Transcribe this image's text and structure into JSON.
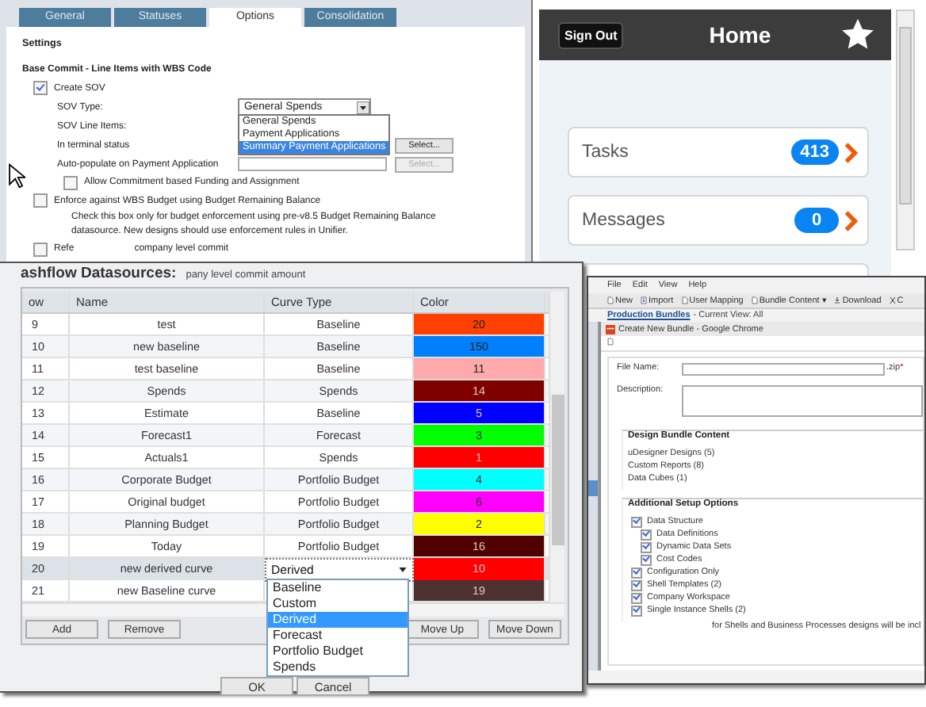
{
  "settings_window": {
    "tabs": [
      {
        "label": "General",
        "selected": false
      },
      {
        "label": "Statuses",
        "selected": false
      },
      {
        "label": "Options",
        "selected": true
      },
      {
        "label": "Consolidation",
        "selected": false
      }
    ],
    "section_title": "Settings",
    "group_title": "Base Commit - Line Items with WBS Code",
    "create_sov": {
      "label": "Create SOV",
      "checked": true
    },
    "fields": [
      {
        "label": "SOV Type:",
        "kind": "dropdown",
        "value": "General Spends"
      },
      {
        "label": "SOV Line Items:",
        "kind": "blank"
      },
      {
        "label": "In terminal status",
        "kind": "select",
        "button": "Select...",
        "disabled": false
      },
      {
        "label": "Auto-populate on Payment Application",
        "kind": "select",
        "button": "Select...",
        "disabled": true
      }
    ],
    "sov_options": [
      {
        "label": "General Spends",
        "selected": false
      },
      {
        "label": "Payment Applications",
        "selected": false
      },
      {
        "label": "Summary Payment Applications",
        "selected": true
      }
    ],
    "allow_commitment": {
      "label": "Allow Commitment based Funding and Assignment",
      "checked": false
    },
    "enforce": {
      "label": "Enforce against WBS Budget using Budget Remaining Balance",
      "checked": false,
      "note": "Check this box only for budget enforcement using pre-v8.5 Budget Remaining Balance datasource. New designs should use enforcement rules in Unifier."
    },
    "refer": {
      "label_start": "Refe",
      "label_end": "company level commit",
      "checked": false
    }
  },
  "mobile_app": {
    "sign_out": "Sign Out",
    "title": "Home",
    "items": [
      {
        "label": "Tasks",
        "count": "413"
      },
      {
        "label": "Messages",
        "count": "0"
      }
    ]
  },
  "datasources_dialog": {
    "heading": "ashflow Datasources:",
    "cut_line": "pany level commit amount",
    "columns": [
      "ow",
      "Name",
      "Curve Type",
      "Color"
    ],
    "rows": [
      {
        "row": "9",
        "name": "test",
        "curve_type": "Baseline",
        "color_value": "20",
        "color": "#ff4000",
        "selected": false
      },
      {
        "row": "10",
        "name": "new baseline",
        "curve_type": "Baseline",
        "color_value": "150",
        "color": "#0080ff",
        "selected": false
      },
      {
        "row": "11",
        "name": "test baseline",
        "curve_type": "Baseline",
        "color_value": "11",
        "color": "#ffaaaa",
        "selected": false
      },
      {
        "row": "12",
        "name": "Spends",
        "curve_type": "Spends",
        "color_value": "14",
        "color": "#800000",
        "selected": false
      },
      {
        "row": "13",
        "name": "Estimate",
        "curve_type": "Baseline",
        "color_value": "5",
        "color": "#0000ff",
        "selected": false
      },
      {
        "row": "14",
        "name": "Forecast1",
        "curve_type": "Forecast",
        "color_value": "3",
        "color": "#00ff00",
        "selected": false
      },
      {
        "row": "15",
        "name": "Actuals1",
        "curve_type": "Spends",
        "color_value": "1",
        "color": "#ff0000",
        "selected": false
      },
      {
        "row": "16",
        "name": "Corporate Budget",
        "curve_type": "Portfolio Budget",
        "color_value": "4",
        "color": "#00ffff",
        "selected": false
      },
      {
        "row": "17",
        "name": "Original budget",
        "curve_type": "Portfolio Budget",
        "color_value": "6",
        "color": "#ff00ff",
        "selected": false
      },
      {
        "row": "18",
        "name": "Planning Budget",
        "curve_type": "Portfolio Budget",
        "color_value": "2",
        "color": "#ffff00",
        "selected": false
      },
      {
        "row": "19",
        "name": "Today",
        "curve_type": "Portfolio Budget",
        "color_value": "16",
        "color": "#500000",
        "selected": false
      },
      {
        "row": "20",
        "name": "new derived curve",
        "curve_type": "Derived",
        "color_value": "10",
        "color": "#ff0000",
        "selected": true,
        "editing": true
      },
      {
        "row": "21",
        "name": "new Baseline curve",
        "color_value": "19",
        "color": "#4d3030",
        "selected": false
      }
    ],
    "curve_menu": [
      {
        "label": "Baseline",
        "selected": false
      },
      {
        "label": "Custom",
        "selected": false
      },
      {
        "label": "Derived",
        "selected": true
      },
      {
        "label": "Forecast",
        "selected": false
      },
      {
        "label": "Portfolio Budget",
        "selected": false
      },
      {
        "label": "Spends",
        "selected": false
      }
    ],
    "buttons_left": [
      "Add",
      "Remove"
    ],
    "buttons_right": [
      "Move Up",
      "Move Down"
    ],
    "footer_buttons": [
      "OK",
      "Cancel"
    ]
  },
  "bundle_window": {
    "menu": [
      "File",
      "Edit",
      "View",
      "Help"
    ],
    "toolbar": [
      {
        "label": "New",
        "kind": "page"
      },
      {
        "label": "Import",
        "kind": "import"
      },
      {
        "label": "User Mapping",
        "kind": "page"
      },
      {
        "label": "Bundle Content ▾",
        "kind": "page"
      },
      {
        "label": "Download",
        "kind": "download"
      },
      {
        "label": "C",
        "kind": "close"
      }
    ],
    "breadcrumb_link": "Production Bundles",
    "breadcrumb_view": "- Current View: All",
    "dialog_title": "Create New Bundle - Google Chrome",
    "file_name_label": "File Name:",
    "file_suffix": ".zip",
    "required_mark": "*",
    "description_label": "Description:",
    "design_title": "Design Bundle Content",
    "design_items": [
      "uDesigner Designs (5)",
      "Custom Reports (8)",
      "Data Cubes (1)"
    ],
    "setup_title": "Additional Setup Options",
    "setup_items": [
      {
        "label": "Data Structure",
        "checked": true,
        "children": [
          {
            "label": "Data Definitions",
            "checked": true
          },
          {
            "label": "Dynamic Data Sets",
            "checked": true
          },
          {
            "label": "Cost Codes",
            "checked": true
          }
        ]
      },
      {
        "label": "Configuration Only",
        "checked": true
      },
      {
        "label": "Shell Templates (2)",
        "checked": true
      },
      {
        "label": "Company Workspace",
        "checked": true
      },
      {
        "label": "Single Instance Shells (2)",
        "checked": true
      }
    ],
    "cut_note": "for Shells and Business Processes designs will be incl"
  }
}
